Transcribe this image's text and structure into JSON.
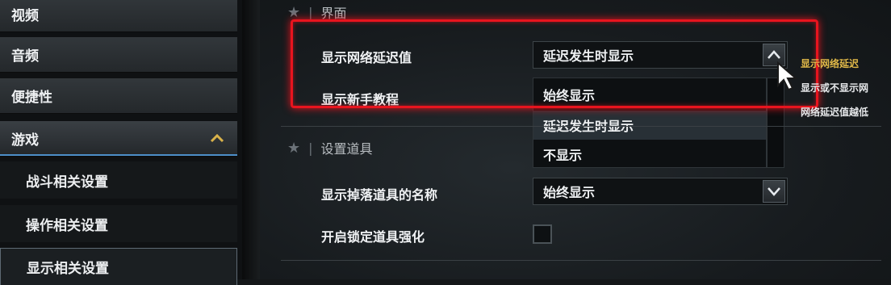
{
  "sidebar": {
    "items": [
      {
        "label": "视频"
      },
      {
        "label": "音频"
      },
      {
        "label": "便捷性"
      },
      {
        "label": "游戏"
      }
    ],
    "sub_items": [
      {
        "label": "战斗相关设置"
      },
      {
        "label": "操作相关设置"
      },
      {
        "label": "显示相关设置"
      }
    ]
  },
  "sections": [
    {
      "title": "界面"
    },
    {
      "title": "设置道具"
    }
  ],
  "settings": {
    "latency": {
      "label": "显示网络延迟值",
      "value": "延迟发生时显示"
    },
    "tutorial": {
      "label": "显示新手教程"
    },
    "drop_name": {
      "label": "显示掉落道具的名称",
      "value": "始终显示"
    },
    "lock_enhance": {
      "label": "开启锁定道具强化",
      "checked": false
    }
  },
  "dropdown_options": [
    "始终显示",
    "延迟发生时显示",
    "不显示"
  ],
  "tooltip": {
    "title": "显示网络延迟",
    "line1": "显示或不显示网",
    "line2": "网络延迟值越低"
  },
  "colors": {
    "highlight": "#e8141e",
    "accent": "#d9b24a"
  }
}
